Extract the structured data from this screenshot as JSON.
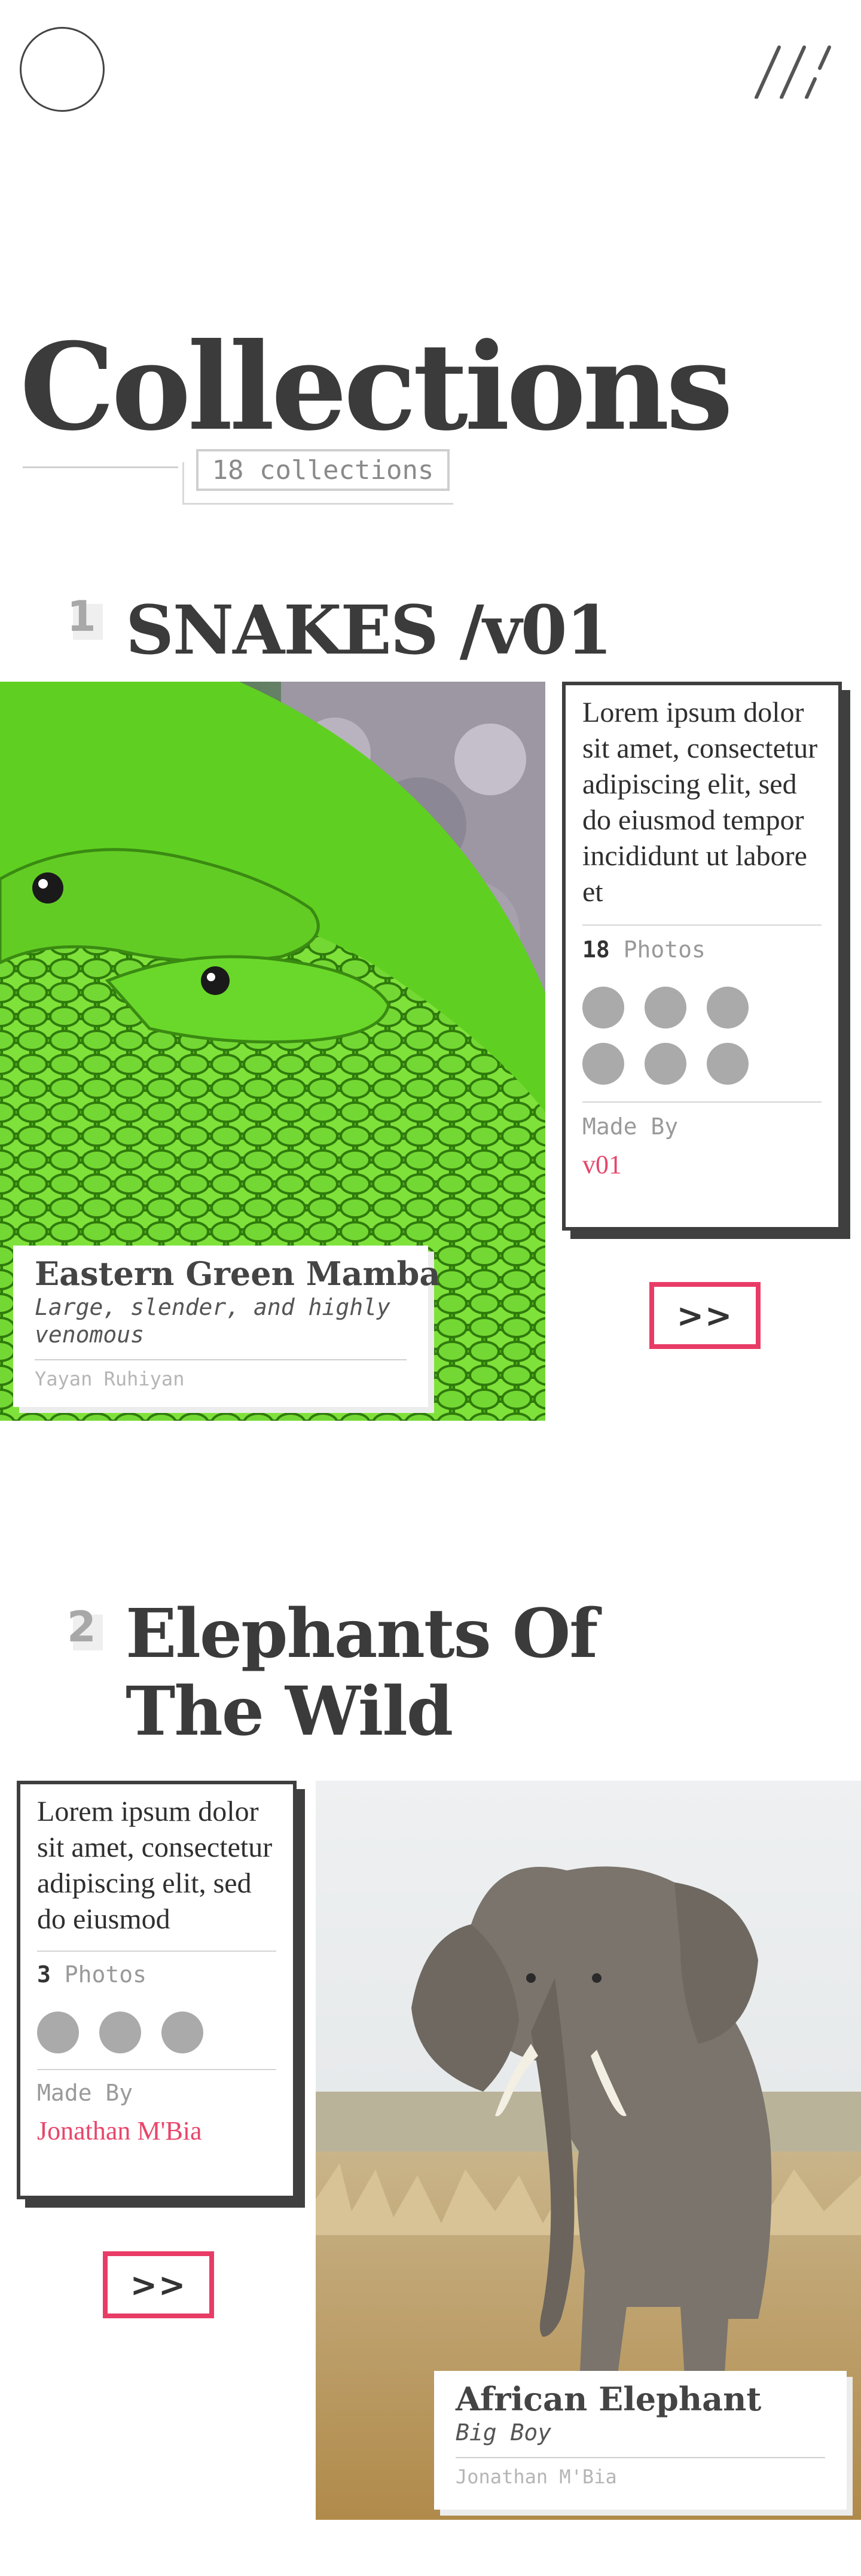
{
  "page": {
    "title": "Collections",
    "count_label": "18 collections"
  },
  "collections": [
    {
      "number": "1",
      "title": "SNAKES /v01",
      "description": "Lorem ipsum dolor sit amet, consectetur adipiscing elit, sed do eiusmod tempor incididunt ut labore et",
      "photo_count": "18",
      "photo_label": "Photos",
      "made_by_label": "Made By",
      "made_by": "v01",
      "next_label": ">>",
      "caption_title": "Eastern Green Mamba",
      "caption_desc": "Large, slender, and highly venomous",
      "caption_author": "Yayan Ruhiyan"
    },
    {
      "number": "2",
      "title": "Elephants Of The Wild",
      "description": "Lorem ipsum dolor sit amet, consectetur adipiscing elit, sed do eiusmod",
      "photo_count": "3",
      "photo_label": "Photos",
      "made_by_label": "Made By",
      "made_by": "Jonathan M'Bia",
      "next_label": ">>",
      "caption_title": "African Elephant",
      "caption_desc": "Big Boy",
      "caption_author": "Jonathan M'Bia"
    }
  ],
  "colors": {
    "accent": "#e83c66",
    "text": "#3b3b3b",
    "muted": "#9a9a9a",
    "thumb": "#aaaaaa"
  },
  "icons": [
    "menu-slashes-icon"
  ]
}
